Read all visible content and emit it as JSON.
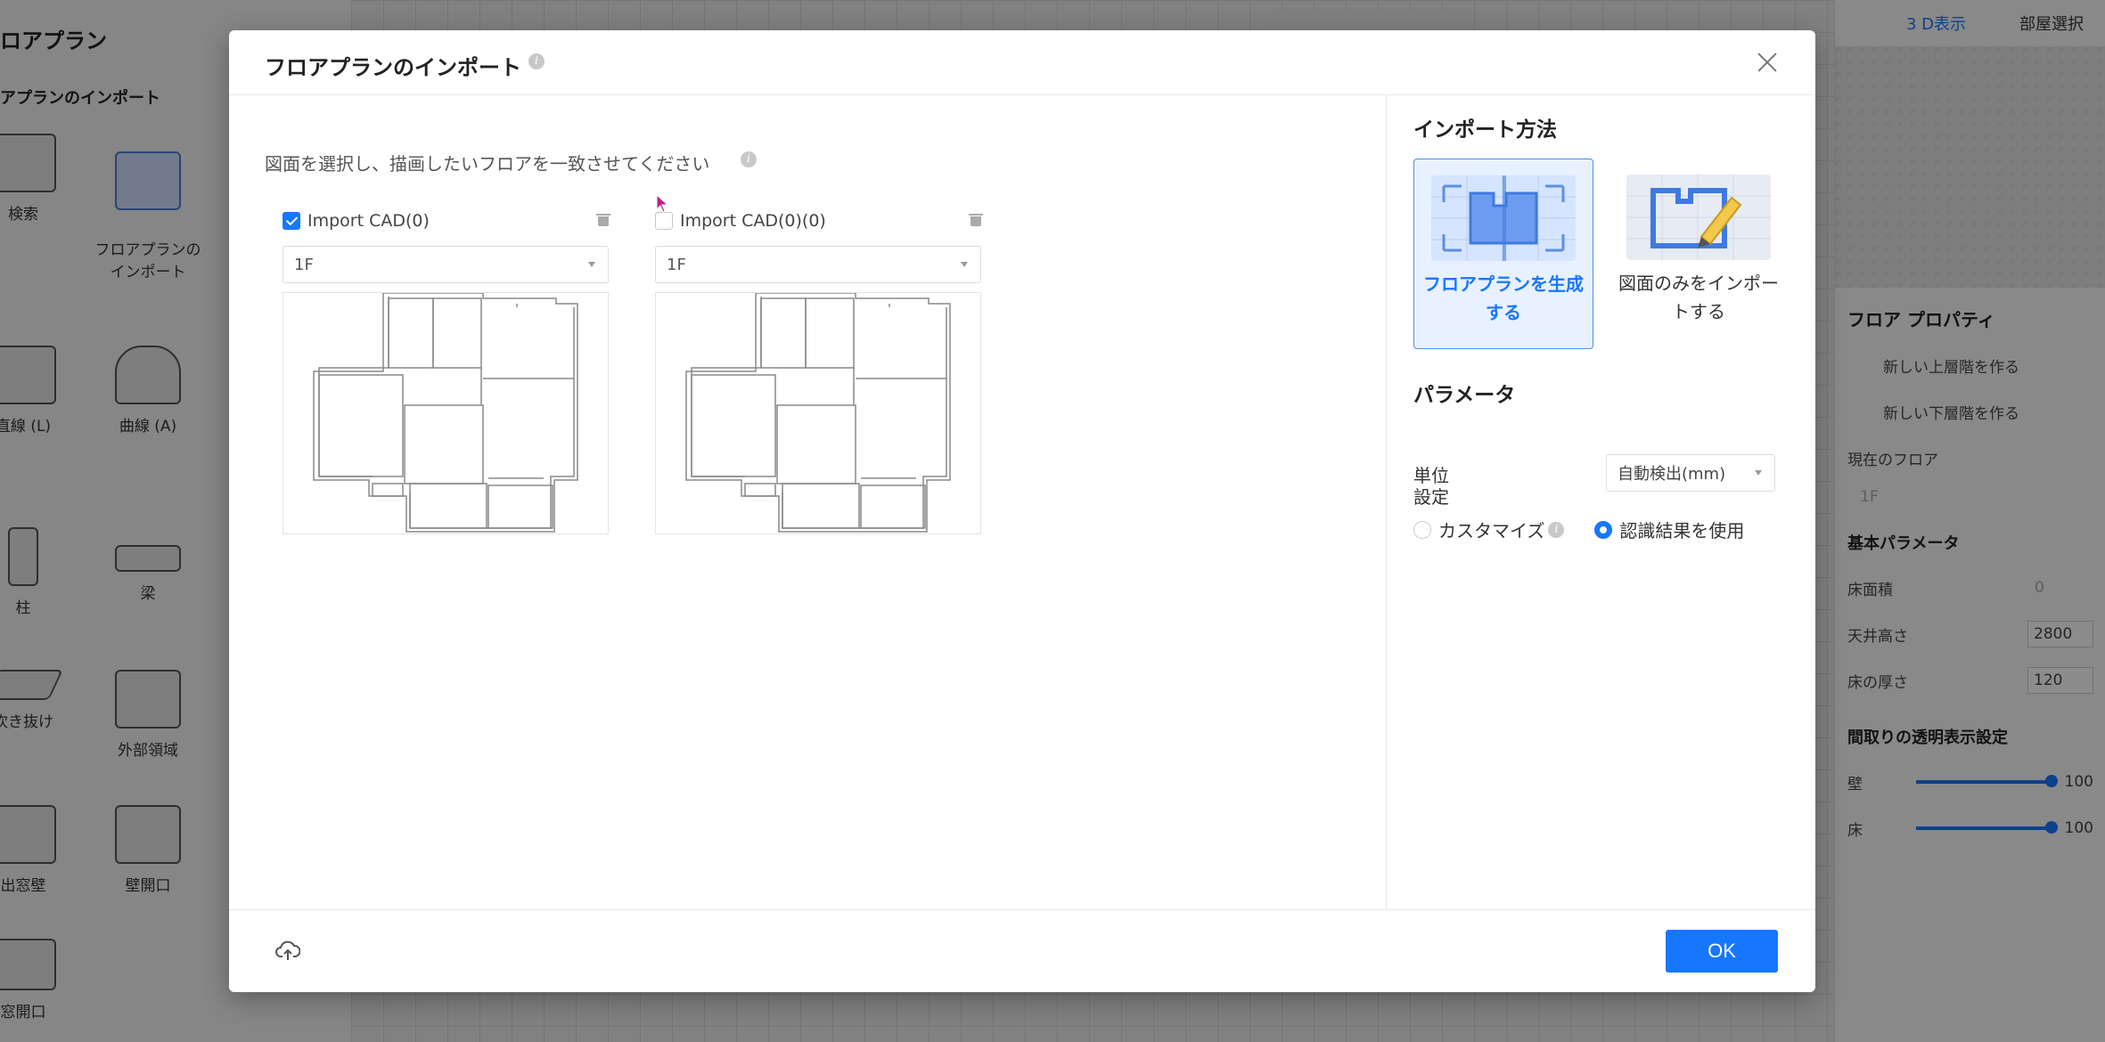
{
  "background": {
    "left_panel": {
      "title": "ロアプラン",
      "subtitle": "アプランのインポート",
      "tools": [
        {
          "label": "検索"
        },
        {
          "label": "フロアプランの\nインポート"
        },
        {
          "label": "直線 (L)"
        },
        {
          "label": "曲線 (A)"
        },
        {
          "label": "柱"
        },
        {
          "label": "梁"
        },
        {
          "label": "吹き抜け"
        },
        {
          "label": "外部領域"
        },
        {
          "label": "出窓壁"
        },
        {
          "label": "壁開口"
        },
        {
          "label": "窓開口"
        }
      ]
    },
    "right_panel": {
      "tab_3d": "3 D表示",
      "tab_room": "部屋選択",
      "title": "フロア プロパティ",
      "add_upper": "新しい上層階を作る",
      "add_lower": "新しい下層階を作る",
      "current_floor_label": "現在のフロア",
      "current_floor_value": "1F",
      "basic_params": "基本パラメータ",
      "floor_area": "床面積",
      "floor_area_value": "0",
      "ceiling_height": "天井高さ",
      "ceiling_height_value": "2800",
      "floor_thickness": "床の厚さ",
      "floor_thickness_value": "120",
      "transparency_title": "間取りの透明表示設定",
      "wall": "壁",
      "wall_value": "100",
      "floor": "床",
      "floor_value": "100"
    }
  },
  "modal": {
    "title": "フロアプランのインポート",
    "instruction": "図面を選択し、描画したいフロアを一致させてください",
    "cards": [
      {
        "name": "Import CAD(0)",
        "checked": true,
        "floor": "1F"
      },
      {
        "name": "Import CAD(0)(0)",
        "checked": false,
        "floor": "1F"
      }
    ],
    "import_method_title": "インポート方法",
    "methods": [
      {
        "label": "フロアプランを生成する",
        "active": true
      },
      {
        "label": "図面のみをインポートする",
        "active": false
      }
    ],
    "params_title": "パラメータ",
    "unit_label": "単位",
    "unit_value": "自動検出(mm)",
    "settings_label": "設定",
    "radio_customize": "カスタマイズ",
    "radio_recognized": "認識結果を使用",
    "ok_label": "OK"
  },
  "colors": {
    "accent": "#1677ff",
    "overlay": "rgba(0,0,0,0.45)"
  }
}
